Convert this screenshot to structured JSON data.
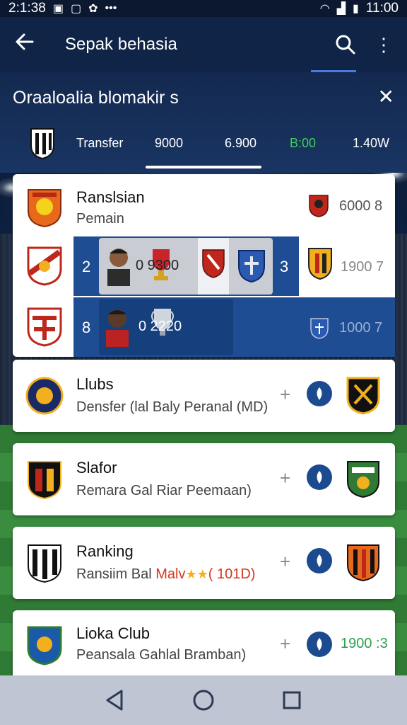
{
  "status_bar": {
    "time_left": "2:1:38",
    "time_right": "11:00"
  },
  "app_bar": {
    "title": "Sepak behasia"
  },
  "header": {
    "title": "Oraaloalia blomakir s",
    "stats": {
      "label": "Transfer",
      "value_1": "9000",
      "value_2": "6.900",
      "value_3": "B:00",
      "value_4": "1.40W"
    }
  },
  "rows": [
    {
      "title": "Ranslsian",
      "subtitle": "Pemain",
      "value": "6000 8"
    },
    {
      "index": "2",
      "score": "0 9300",
      "right_index": "3",
      "value": "1900 7"
    },
    {
      "index": "8",
      "score": "0 2220",
      "value": "1000 7"
    },
    {
      "title": "Llubs",
      "subtitle": "Densfer (lal Baly Peranal (MD)"
    },
    {
      "title": "Slafor",
      "subtitle": "Remara Gal Riar Peemaan)"
    },
    {
      "title": "Ranking",
      "subtitle_prefix": "Ransiim Bal ",
      "subtitle_highlight": "Malv",
      "subtitle_suffix": "( 101D)"
    },
    {
      "title": "Lioka Club",
      "subtitle": "Peansala Gahlal Bramban)",
      "value": "1900 :3"
    }
  ],
  "colors": {
    "brand_navy": "#0f2447",
    "accent_blue": "#1e4d93",
    "download_blue": "#1c4a8f",
    "positive_green": "#3ecf5a",
    "highlight_red": "#d4351c",
    "star_gold": "#f2b01e"
  }
}
